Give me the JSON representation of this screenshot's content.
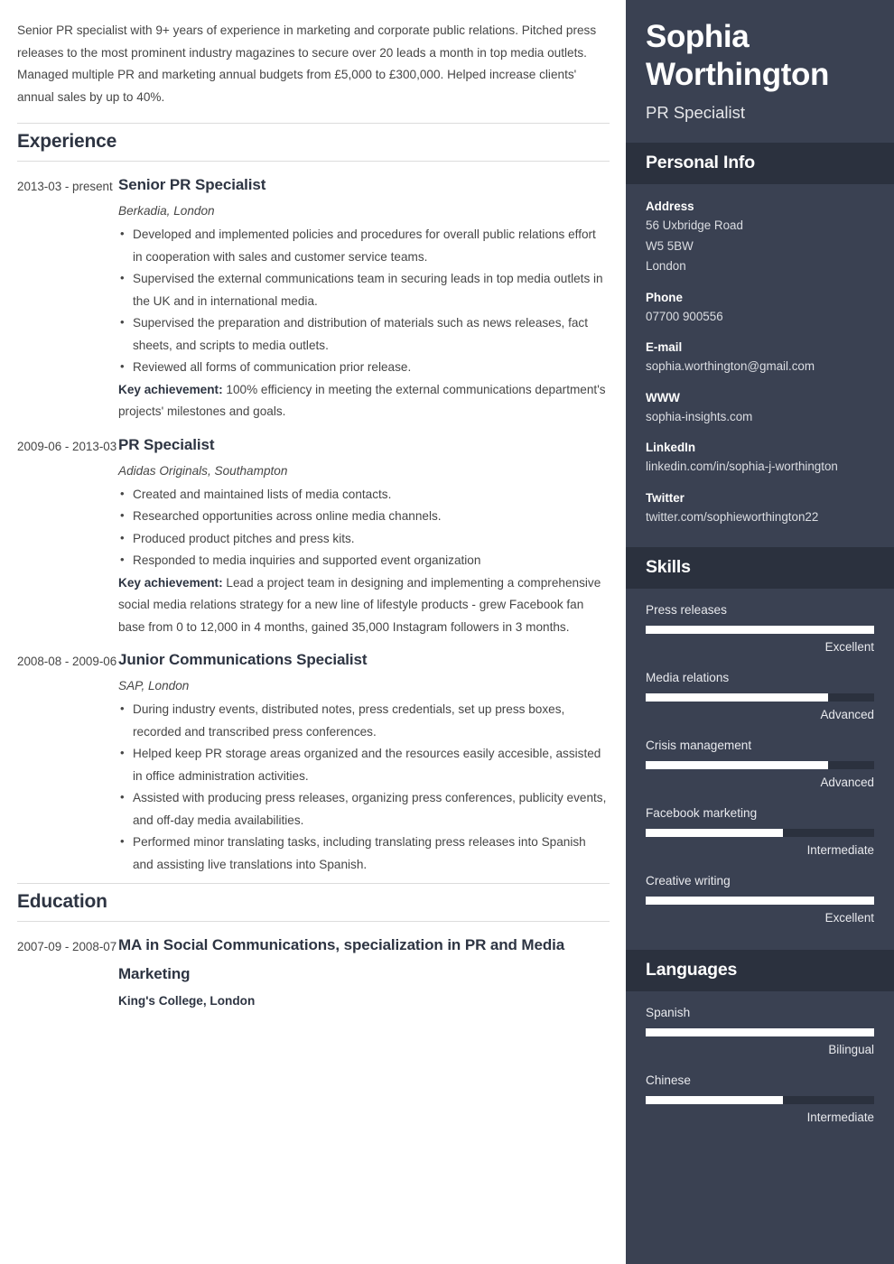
{
  "colors": {
    "sidebar_bg": "#3a4152",
    "band_bg": "#2b313e",
    "heading": "#2d3442",
    "body_text": "#464646",
    "bar_fill": "#ffffff"
  },
  "main": {
    "summary": "Senior PR specialist with 9+ years of experience in marketing and corporate public relations. Pitched press releases to the most prominent industry magazines to secure over 20 leads a month in top media outlets. Managed multiple PR and marketing annual budgets from £5,000 to £300,000. Helped increase clients' annual sales by up to 40%.",
    "experience": {
      "heading": "Experience",
      "entries": [
        {
          "dates": "2013-03 - present",
          "title": "Senior PR Specialist",
          "company": "Berkadia, London",
          "bullets": [
            "Developed and implemented policies and procedures for overall public relations effort in cooperation with sales and customer service teams.",
            "Supervised the external communications team in securing leads in top media outlets in the UK and in international media.",
            "Supervised the preparation and distribution of materials such as news releases, fact sheets, and scripts to media outlets.",
            "Reviewed all forms of communication prior release."
          ],
          "achievement_label": "Key achievement:",
          "achievement_text": "100% efficiency in meeting the external communications department's projects' milestones and goals."
        },
        {
          "dates": "2009-06 - 2013-03",
          "title": "PR Specialist",
          "company": "Adidas Originals, Southampton",
          "bullets": [
            "Created and maintained lists of media contacts.",
            "Researched opportunities across online media channels.",
            "Produced product pitches and press kits.",
            "Responded to media inquiries and supported event organization"
          ],
          "achievement_label": "Key achievement:",
          "achievement_text": "Lead a project team in designing and implementing a comprehensive social media relations strategy for a new line of lifestyle products - grew Facebook fan base from 0 to 12,000 in 4 months, gained 35,000 Instagram followers in 3 months."
        },
        {
          "dates": "2008-08 - 2009-06",
          "title": "Junior Communications Specialist",
          "company": "SAP, London",
          "bullets": [
            "During industry events, distributed notes, press credentials, set up press boxes, recorded and transcribed press conferences.",
            "Helped keep PR storage areas organized and the resources easily accesible, assisted in office administration activities.",
            "Assisted with producing press releases, organizing press conferences, publicity events, and off-day media availabilities.",
            "Performed minor translating tasks, including translating press releases into Spanish and assisting live translations into Spanish."
          ],
          "achievement_label": "",
          "achievement_text": ""
        }
      ]
    },
    "education": {
      "heading": "Education",
      "entries": [
        {
          "dates": "2007-09 - 2008-07",
          "degree": "MA in Social Communications, specialization in PR and Media Marketing",
          "school": "King's College, London"
        }
      ]
    }
  },
  "sidebar": {
    "name": "Sophia Worthington",
    "job_title": "PR Specialist",
    "personal_info": {
      "heading": "Personal Info",
      "items": [
        {
          "label": "Address",
          "values": [
            "56 Uxbridge Road",
            "W5 5BW",
            "London"
          ]
        },
        {
          "label": "Phone",
          "values": [
            "07700 900556"
          ]
        },
        {
          "label": "E-mail",
          "values": [
            "sophia.worthington@gmail.com"
          ]
        },
        {
          "label": "WWW",
          "values": [
            "sophia-insights.com"
          ]
        },
        {
          "label": "LinkedIn",
          "values": [
            "linkedin.com/in/sophia-j-worthington"
          ]
        },
        {
          "label": "Twitter",
          "values": [
            "twitter.com/sophieworthington22"
          ]
        }
      ]
    },
    "skills": {
      "heading": "Skills",
      "items": [
        {
          "name": "Press releases",
          "level": "Excellent",
          "percent": 100
        },
        {
          "name": "Media relations",
          "level": "Advanced",
          "percent": 80
        },
        {
          "name": "Crisis management",
          "level": "Advanced",
          "percent": 80
        },
        {
          "name": "Facebook marketing",
          "level": "Intermediate",
          "percent": 60
        },
        {
          "name": "Creative writing",
          "level": "Excellent",
          "percent": 100
        }
      ]
    },
    "languages": {
      "heading": "Languages",
      "items": [
        {
          "name": "Spanish",
          "level": "Bilingual",
          "percent": 100
        },
        {
          "name": "Chinese",
          "level": "Intermediate",
          "percent": 60
        }
      ]
    }
  }
}
